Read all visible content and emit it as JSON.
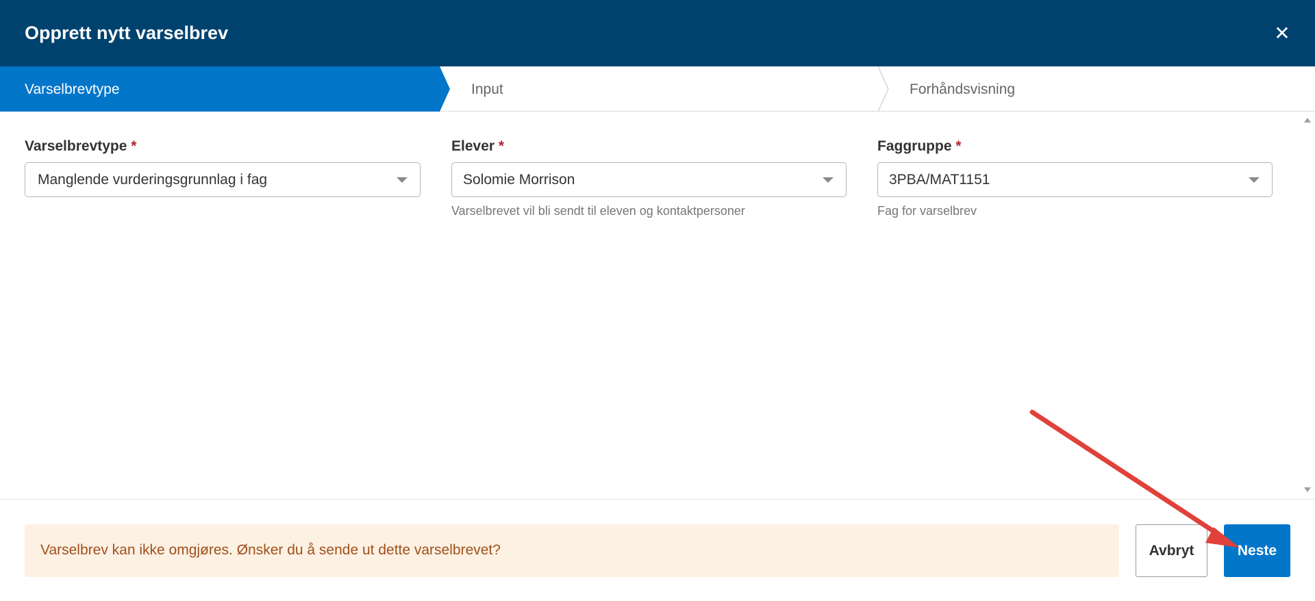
{
  "dialog": {
    "title": "Opprett nytt varselbrev",
    "close_symbol": "✕"
  },
  "steps": [
    {
      "label": "Varselbrevtype",
      "active": true
    },
    {
      "label": "Input",
      "active": false
    },
    {
      "label": "Forhåndsvisning",
      "active": false
    }
  ],
  "form": {
    "required_marker": "*",
    "fields": [
      {
        "label": "Varselbrevtype",
        "value": "Manglende vurderingsgrunnlag i fag",
        "hint": ""
      },
      {
        "label": "Elever",
        "value": "Solomie Morrison",
        "hint": "Varselbrevet vil bli sendt til eleven og kontaktpersoner"
      },
      {
        "label": "Faggruppe",
        "value": "3PBA/MAT1151",
        "hint": "Fag for varselbrev"
      }
    ]
  },
  "footer": {
    "warning": "Varselbrev kan ikke omgjøres. Ønsker du å sende ut dette varselbrevet?",
    "cancel_label": "Avbryt",
    "next_label": "Neste"
  },
  "colors": {
    "header_bg": "#00426e",
    "active_step_bg": "#0276c9",
    "primary_button": "#0276c9",
    "warning_bg": "#fdf1e4",
    "warning_text": "#a0501b",
    "required": "#b3262c",
    "annotation_arrow": "#e0413a"
  },
  "icons": {
    "close": "close-icon",
    "dropdown": "chevron-down-icon",
    "annotation": "arrow-annotation-icon"
  }
}
